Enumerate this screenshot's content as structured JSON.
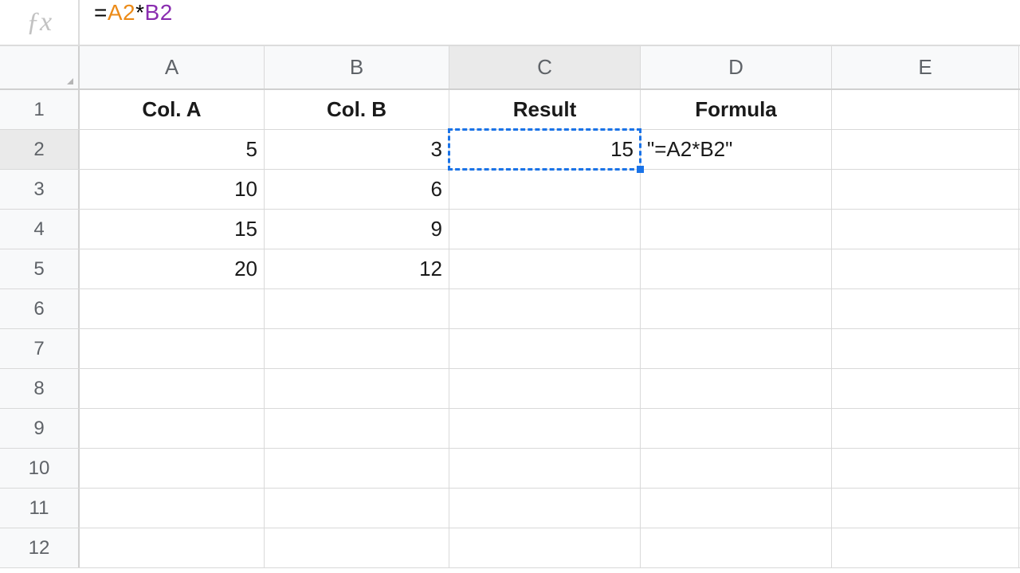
{
  "formula_bar": {
    "eq": "=",
    "ref_a": "A2",
    "star": "*",
    "ref_b": "B2"
  },
  "columns": [
    "A",
    "B",
    "C",
    "D",
    "E"
  ],
  "active_column_index": 2,
  "active_row_index": 1,
  "row_numbers": [
    "1",
    "2",
    "3",
    "4",
    "5",
    "6",
    "7",
    "8",
    "9",
    "10",
    "11",
    "12"
  ],
  "headers": {
    "a": "Col. A",
    "b": "Col. B",
    "c": "Result",
    "d": "Formula"
  },
  "data": {
    "r2": {
      "a": "5",
      "b": "3",
      "c": "15",
      "d": "\"=A2*B2\""
    },
    "r3": {
      "a": "10",
      "b": "6"
    },
    "r4": {
      "a": "15",
      "b": "9"
    },
    "r5": {
      "a": "20",
      "b": "12"
    }
  },
  "chart_data": {
    "type": "table",
    "title": "",
    "columns": [
      "Col. A",
      "Col. B",
      "Result",
      "Formula"
    ],
    "rows": [
      {
        "Col. A": 5,
        "Col. B": 3,
        "Result": 15,
        "Formula": "=A2*B2"
      },
      {
        "Col. A": 10,
        "Col. B": 6,
        "Result": null,
        "Formula": null
      },
      {
        "Col. A": 15,
        "Col. B": 9,
        "Result": null,
        "Formula": null
      },
      {
        "Col. A": 20,
        "Col. B": 12,
        "Result": null,
        "Formula": null
      }
    ]
  }
}
